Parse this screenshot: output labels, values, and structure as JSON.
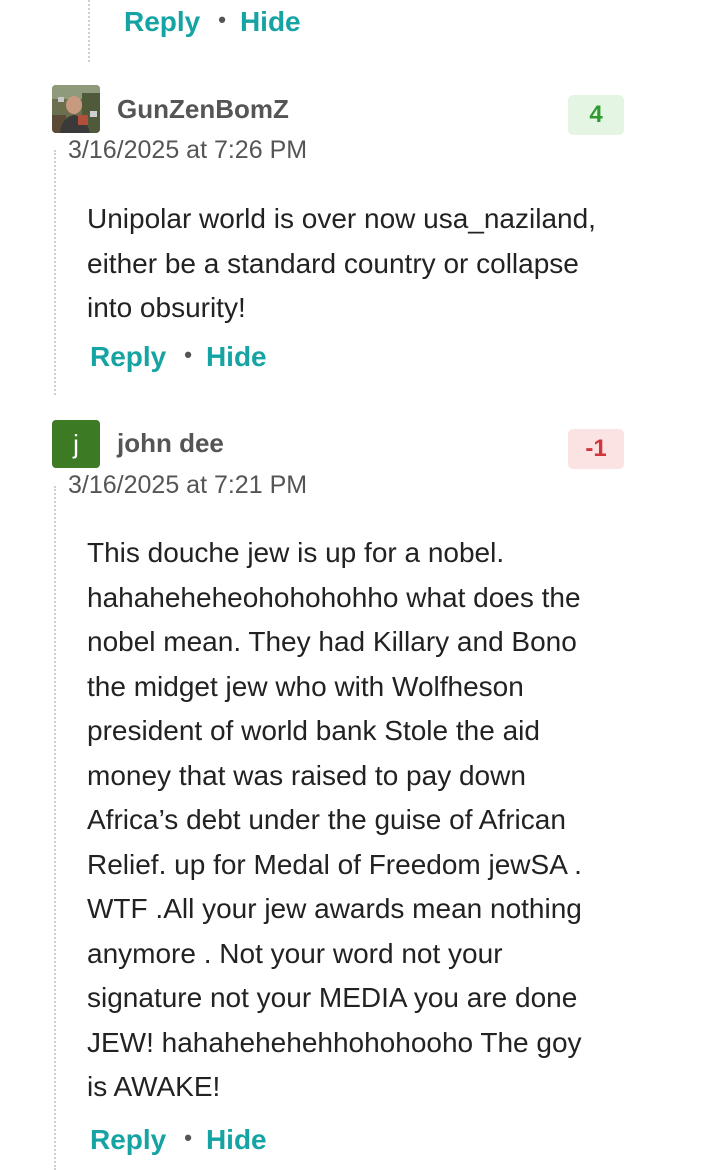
{
  "top_actions": {
    "reply": "Reply",
    "separator": "•",
    "hide": "Hide"
  },
  "comments": [
    {
      "username": "GunZenBomZ",
      "avatar": "photo-avatar",
      "timestamp": "3/16/2025 at 7:26 PM",
      "score": "4",
      "score_color": "#2f9a2f",
      "body": "Unipolar world is over now usa_naziland,\neither be a standard country or collapse\ninto obsurity!",
      "actions": {
        "reply": "Reply",
        "separator": "•",
        "hide": "Hide"
      }
    },
    {
      "username": "john dee",
      "avatar_letter": "j",
      "avatar_color": "#3d7a24",
      "timestamp": "3/16/2025 at 7:21 PM",
      "score": "-1",
      "score_color": "#d0373d",
      "body": "This douche jew is up for a nobel.\nhahaheheheohohohohho what does the\nnobel mean. They had Killary and Bono\nthe midget jew who with Wolfheson\npresident of world bank Stole the aid\nmoney that was raised to pay down\nAfrica’s debt under the guise of African\nRelief. up for Medal of Freedom jewSA .\nWTF .All your jew awards mean nothing\nanymore . Not your word not your\nsignature not your MEDIA you are done\nJEW! hahahehehehhohohooho The goy\nis AWAKE!",
      "actions": {
        "reply": "Reply",
        "separator": "•",
        "hide": "Hide"
      }
    }
  ]
}
